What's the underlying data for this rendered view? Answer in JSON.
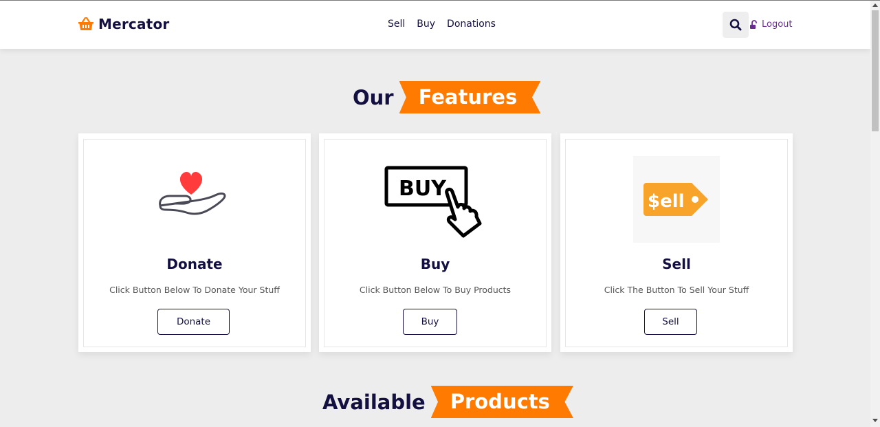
{
  "header": {
    "brand": "Mercator",
    "nav": [
      {
        "label": "Sell"
      },
      {
        "label": "Buy"
      },
      {
        "label": "Donations"
      }
    ],
    "logout_label": "Logout"
  },
  "features": {
    "title_plain": "Our",
    "title_highlight": "Features",
    "cards": [
      {
        "title": "Donate",
        "description": "Click Button Below To Donate Your Stuff",
        "button": "Donate",
        "icon": "heart-hand-icon"
      },
      {
        "title": "Buy",
        "description": "Click Button Below To Buy Products",
        "button": "Buy",
        "icon": "buy-click-icon"
      },
      {
        "title": "Sell",
        "description": "Click The Button To Sell Your Stuff",
        "button": "Sell",
        "icon": "sell-tag-icon",
        "icon_text": "$ell"
      }
    ]
  },
  "products": {
    "title_plain": "Available",
    "title_highlight": "Products"
  },
  "colors": {
    "accent": "#ff7a00",
    "navy": "#130f40",
    "heart": "#ff3b3b",
    "sell_tag": "#f8a42a",
    "logout": "#6a2c91"
  }
}
